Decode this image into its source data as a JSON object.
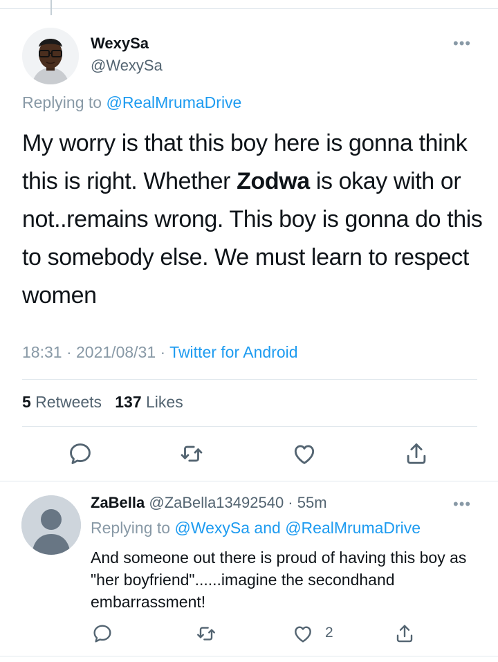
{
  "main_tweet": {
    "display_name": "WexySa",
    "handle": "@WexySa",
    "more_label": "•••",
    "replying_prefix": "Replying to ",
    "replying_to": "@RealMrumaDrive",
    "text_part1": "My worry is that this boy here is gonna think this is right. Whether ",
    "text_bold": "Zodwa",
    "text_part2": " is okay with or not..remains wrong. This boy is gonna do this to somebody else. We must learn to respect women",
    "time": "18:31",
    "sep1": " · ",
    "date": "2021/08/31",
    "sep2": " · ",
    "source": "Twitter for Android",
    "retweets_count": "5",
    "retweets_label": " Retweets",
    "likes_count": "137",
    "likes_label": " Likes",
    "icons": [
      "reply-icon",
      "retweet-icon",
      "like-icon",
      "share-icon"
    ]
  },
  "reply_tweet": {
    "display_name": "ZaBella",
    "handle_time": " @ZaBella13492540 · 55m",
    "more_label": "•••",
    "replying_prefix": "Replying to ",
    "replying_to_1": "@WexySa",
    "replying_and": " and ",
    "replying_to_2": "@RealMrumaDrive",
    "text": "And someone out there is proud of having this boy as \"her boyfriend\"......imagine the secondhand embarrassment!",
    "like_count": "2",
    "icons": [
      "reply-icon",
      "retweet-icon",
      "like-icon",
      "share-icon"
    ]
  },
  "colors": {
    "link": "#1d9bf0",
    "secondary_text": "#536471",
    "divider": "#e1e8ed"
  }
}
